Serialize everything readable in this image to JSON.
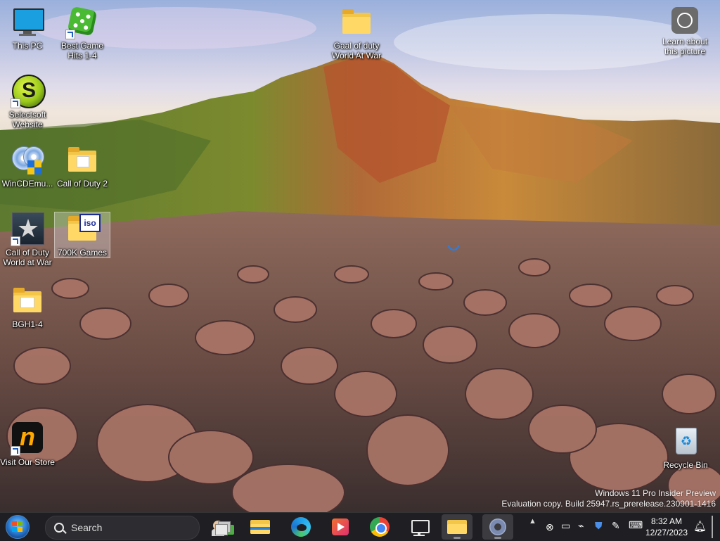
{
  "desktop": {
    "icons": [
      {
        "label": "This PC"
      },
      {
        "label": "Best Game Hits 1-4"
      },
      {
        "label": "Selectsoft Website"
      },
      {
        "label": "WinCDEmu..."
      },
      {
        "label": "Call of Duty 2"
      },
      {
        "label": "Call of Duty World at War"
      },
      {
        "label": "700K Games"
      },
      {
        "label": "BGH1-4"
      },
      {
        "label": "Visit Our Store"
      },
      {
        "label": "Gaal of duty World At War"
      },
      {
        "label": "Learn about this picture"
      },
      {
        "label": "Recycle Bin"
      }
    ],
    "iso_badge": "iso"
  },
  "watermark": {
    "line1": "Windows 11 Pro Insider Preview",
    "line2": "Evaluation copy. Build 25947.rs_prerelease.230901-1416"
  },
  "taskbar": {
    "search_label": "Search",
    "apps": [
      "task-view",
      "file-explorer",
      "edge",
      "media-player",
      "chrome",
      "remote-desktop",
      "file-explorer-window",
      "settings"
    ],
    "clock": {
      "time": "8:32 AM",
      "date": "12/27/2023"
    }
  },
  "colors": {
    "taskbar_bg": "#1f1f23",
    "folder": "#f3c64a",
    "accent": "#2c7fd6"
  }
}
